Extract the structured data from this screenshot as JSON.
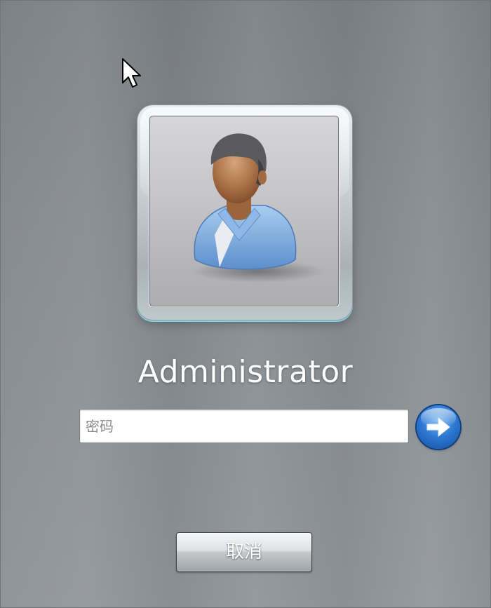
{
  "login": {
    "username": "Administrator",
    "password_placeholder": "密码",
    "password_value": "",
    "cancel_label": "取消",
    "submit_icon": "arrow-right-icon",
    "avatar_icon": "user-avatar-icon",
    "cursor_icon": "mouse-pointer-icon"
  },
  "colors": {
    "background": "#868b8f",
    "submit_button": "#2f7ad6",
    "tile_glow": "#7fd2e2",
    "text": "#ffffff"
  }
}
